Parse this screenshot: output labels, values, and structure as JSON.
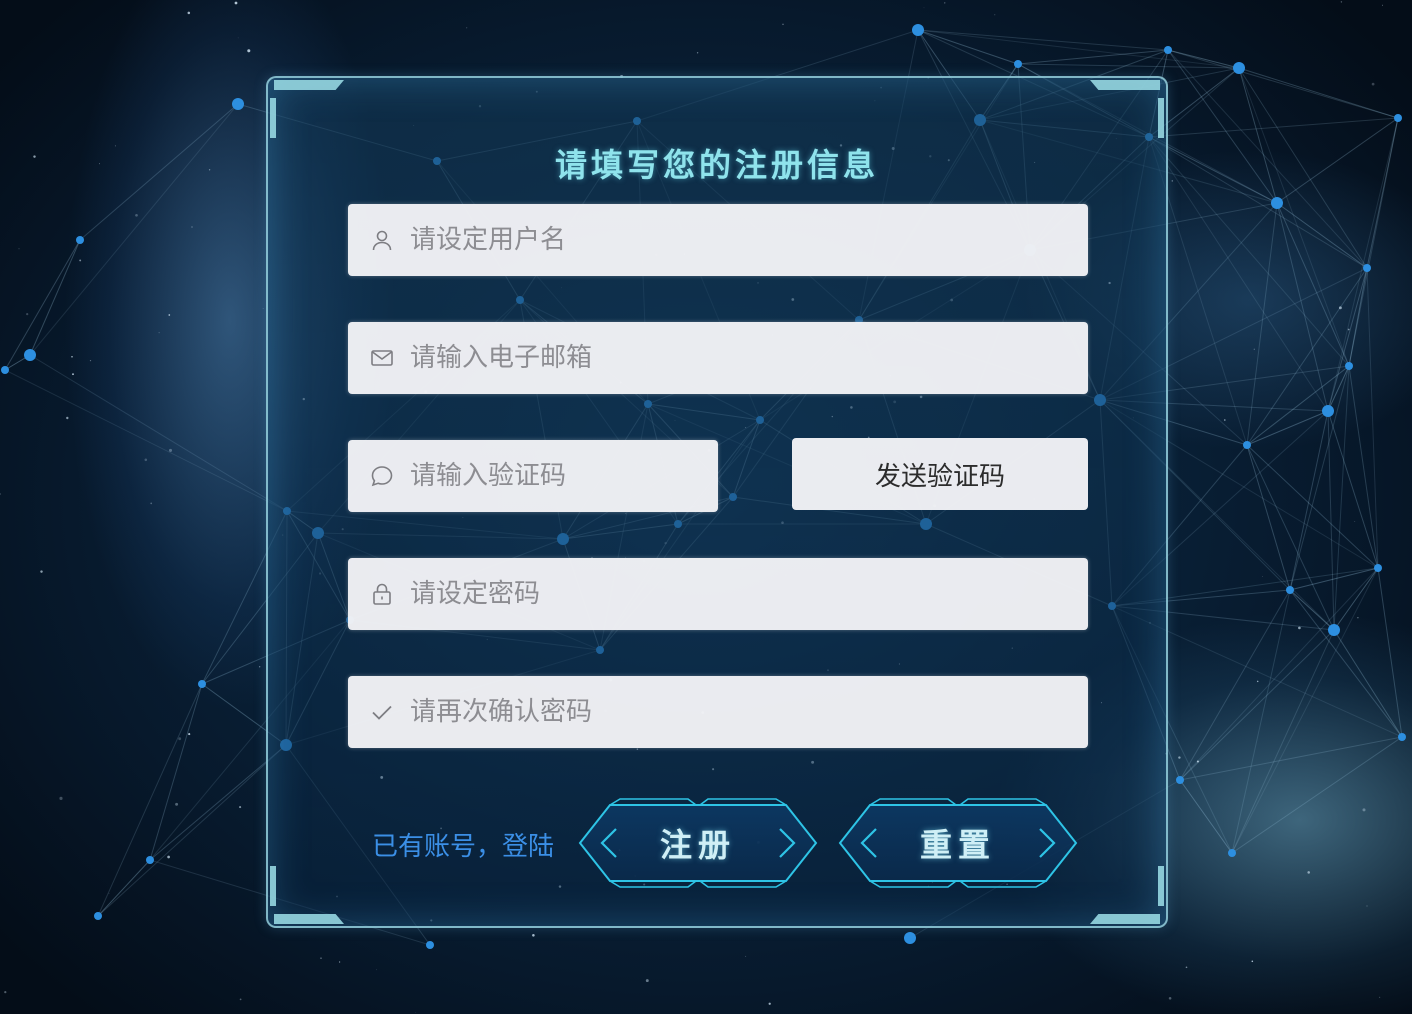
{
  "form": {
    "title": "请填写您的注册信息",
    "username": {
      "placeholder": "请设定用户名",
      "icon": "user-icon"
    },
    "email": {
      "placeholder": "请输入电子邮箱",
      "icon": "mail-icon"
    },
    "code": {
      "placeholder": "请输入验证码",
      "icon": "chat-bubble-icon"
    },
    "send_code_label": "发送验证码",
    "password": {
      "placeholder": "请设定密码",
      "icon": "lock-icon"
    },
    "confirm": {
      "placeholder": "请再次确认密码",
      "icon": "check-icon"
    },
    "login_link": "已有账号，登陆",
    "register_label": "注册",
    "reset_label": "重置"
  },
  "colors": {
    "accent": "#8fe3ec",
    "link": "#3b8fe6",
    "field_bg": "#f4f4f7",
    "button_stroke": "#2ec4e6"
  }
}
